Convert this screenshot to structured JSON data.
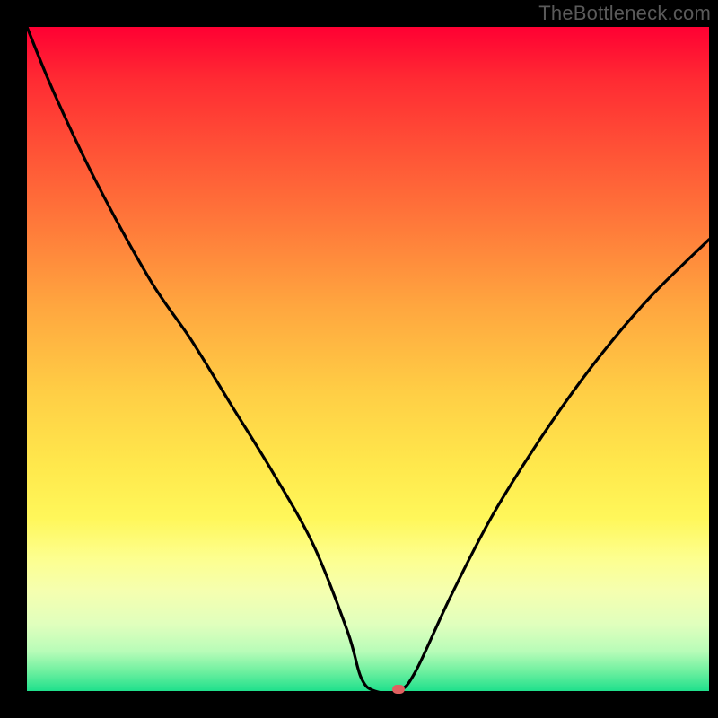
{
  "watermark": "TheBottleneck.com",
  "colors": {
    "frame_bg": "#000000",
    "gradient_top": "#ff0033",
    "gradient_bottom": "#1fe08c",
    "curve_stroke": "#000000",
    "marker_fill": "#e06060",
    "watermark_text": "#5a5a5a"
  },
  "chart_data": {
    "type": "line",
    "title": "",
    "xlabel": "",
    "ylabel": "",
    "x": [
      0.0,
      0.04,
      0.1,
      0.18,
      0.24,
      0.3,
      0.36,
      0.42,
      0.47,
      0.49,
      0.51,
      0.545,
      0.57,
      0.62,
      0.68,
      0.74,
      0.8,
      0.86,
      0.92,
      1.0
    ],
    "values": [
      100,
      90,
      77,
      62,
      53,
      43,
      33,
      22,
      9,
      2,
      0,
      0,
      3,
      14,
      26,
      36,
      45,
      53,
      60,
      68
    ],
    "xlim": [
      0,
      1
    ],
    "ylim": [
      0,
      100
    ],
    "marker": {
      "x": 0.545,
      "y": 0
    },
    "notes": "V-shaped bottleneck curve; minimum (zero bottleneck) around x≈0.53. No axis tick labels are visible in the image; background encodes value via color gradient from red (high) to green (low)."
  }
}
